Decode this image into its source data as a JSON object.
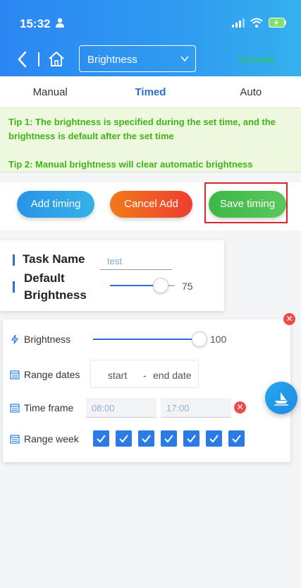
{
  "status": {
    "time": "15:32"
  },
  "nav": {
    "select_value": "Brightness",
    "terminal_label": "Terminal"
  },
  "tabs": [
    {
      "label": "Manual"
    },
    {
      "label": "Timed"
    },
    {
      "label": "Auto"
    }
  ],
  "tips": {
    "tip1": "Tip 1: The brightness is specified during the set time, and the brightness is default after the set time",
    "tip2": "Tip 2: Manual brightness will clear automatic brightness"
  },
  "actions": {
    "add": "Add timing",
    "cancel": "Cancel Add",
    "save": "Save timing"
  },
  "task": {
    "name_label": "Task Name",
    "name_value": "test",
    "brightness_label_1": "Default",
    "brightness_label_2": "Brightness",
    "brightness_value": "75"
  },
  "schedule": {
    "brightness_label": "Brightness",
    "brightness_value": "100",
    "range_dates_label": "Range dates",
    "start_placeholder": "start",
    "dash": "-",
    "end_placeholder": "end date",
    "time_frame_label": "Time frame",
    "time_start": "08:00",
    "time_end": "17:00",
    "range_week_label": "Range week",
    "week_days_checked": [
      true,
      true,
      true,
      true,
      true,
      true,
      true
    ]
  },
  "colors": {
    "accent": "#2a6fd6",
    "tip_green": "#3fb517",
    "highlight": "#d42a2a"
  }
}
